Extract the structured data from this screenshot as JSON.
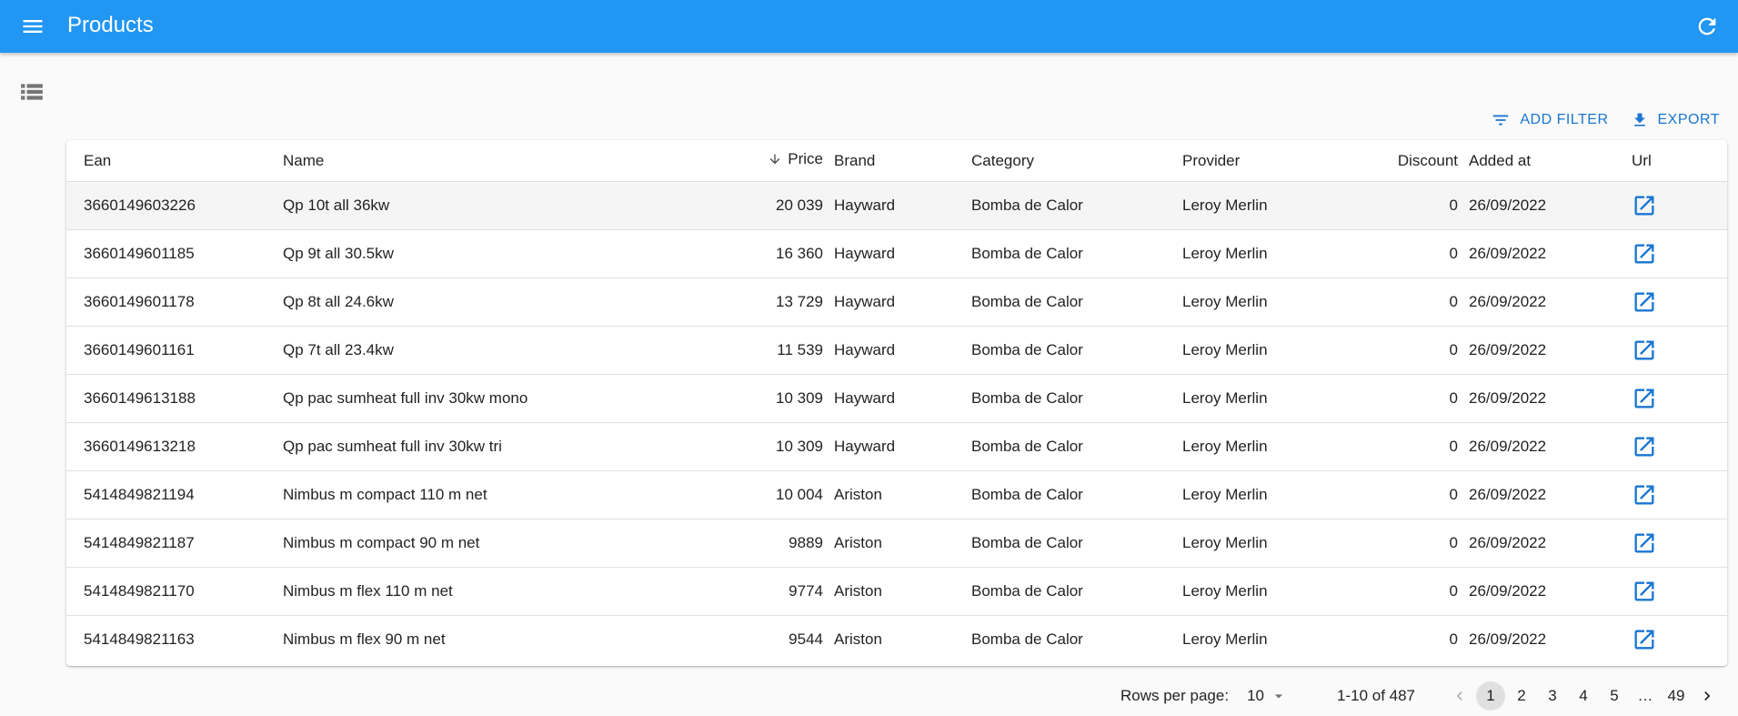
{
  "header": {
    "title": "Products"
  },
  "toolbar": {
    "add_filter": "ADD FILTER",
    "export": "EXPORT"
  },
  "table": {
    "columns": [
      "Ean",
      "Name",
      "Price",
      "Brand",
      "Category",
      "Provider",
      "Discount",
      "Added at",
      "Url"
    ],
    "sort_column": "Price",
    "sort_direction": "descending",
    "rows": [
      {
        "ean": "3660149603226",
        "name": "Qp 10t all 36kw",
        "price": "20 039",
        "brand": "Hayward",
        "category": "Bomba de Calor",
        "provider": "Leroy Merlin",
        "discount": "0",
        "added": "26/09/2022"
      },
      {
        "ean": "3660149601185",
        "name": "Qp 9t all 30.5kw",
        "price": "16 360",
        "brand": "Hayward",
        "category": "Bomba de Calor",
        "provider": "Leroy Merlin",
        "discount": "0",
        "added": "26/09/2022"
      },
      {
        "ean": "3660149601178",
        "name": "Qp 8t all 24.6kw",
        "price": "13 729",
        "brand": "Hayward",
        "category": "Bomba de Calor",
        "provider": "Leroy Merlin",
        "discount": "0",
        "added": "26/09/2022"
      },
      {
        "ean": "3660149601161",
        "name": "Qp 7t all 23.4kw",
        "price": "11 539",
        "brand": "Hayward",
        "category": "Bomba de Calor",
        "provider": "Leroy Merlin",
        "discount": "0",
        "added": "26/09/2022"
      },
      {
        "ean": "3660149613188",
        "name": "Qp pac sumheat full inv 30kw mono",
        "price": "10 309",
        "brand": "Hayward",
        "category": "Bomba de Calor",
        "provider": "Leroy Merlin",
        "discount": "0",
        "added": "26/09/2022"
      },
      {
        "ean": "3660149613218",
        "name": "Qp pac sumheat full inv 30kw tri",
        "price": "10 309",
        "brand": "Hayward",
        "category": "Bomba de Calor",
        "provider": "Leroy Merlin",
        "discount": "0",
        "added": "26/09/2022"
      },
      {
        "ean": "5414849821194",
        "name": "Nimbus m compact 110 m net",
        "price": "10 004",
        "brand": "Ariston",
        "category": "Bomba de Calor",
        "provider": "Leroy Merlin",
        "discount": "0",
        "added": "26/09/2022"
      },
      {
        "ean": "5414849821187",
        "name": "Nimbus m compact 90 m net",
        "price": "9889",
        "brand": "Ariston",
        "category": "Bomba de Calor",
        "provider": "Leroy Merlin",
        "discount": "0",
        "added": "26/09/2022"
      },
      {
        "ean": "5414849821170",
        "name": "Nimbus m flex 110 m net",
        "price": "9774",
        "brand": "Ariston",
        "category": "Bomba de Calor",
        "provider": "Leroy Merlin",
        "discount": "0",
        "added": "26/09/2022"
      },
      {
        "ean": "5414849821163",
        "name": "Nimbus m flex 90 m net",
        "price": "9544",
        "brand": "Ariston",
        "category": "Bomba de Calor",
        "provider": "Leroy Merlin",
        "discount": "0",
        "added": "26/09/2022"
      }
    ]
  },
  "pagination": {
    "rows_per_page_label": "Rows per page:",
    "rows_per_page": "10",
    "range": "1-10 of 487",
    "pages": [
      "1",
      "2",
      "3",
      "4",
      "5",
      "…",
      "49"
    ],
    "current_page": "1"
  },
  "colors": {
    "appbar": "#2196f3",
    "accent": "#1976d2"
  }
}
